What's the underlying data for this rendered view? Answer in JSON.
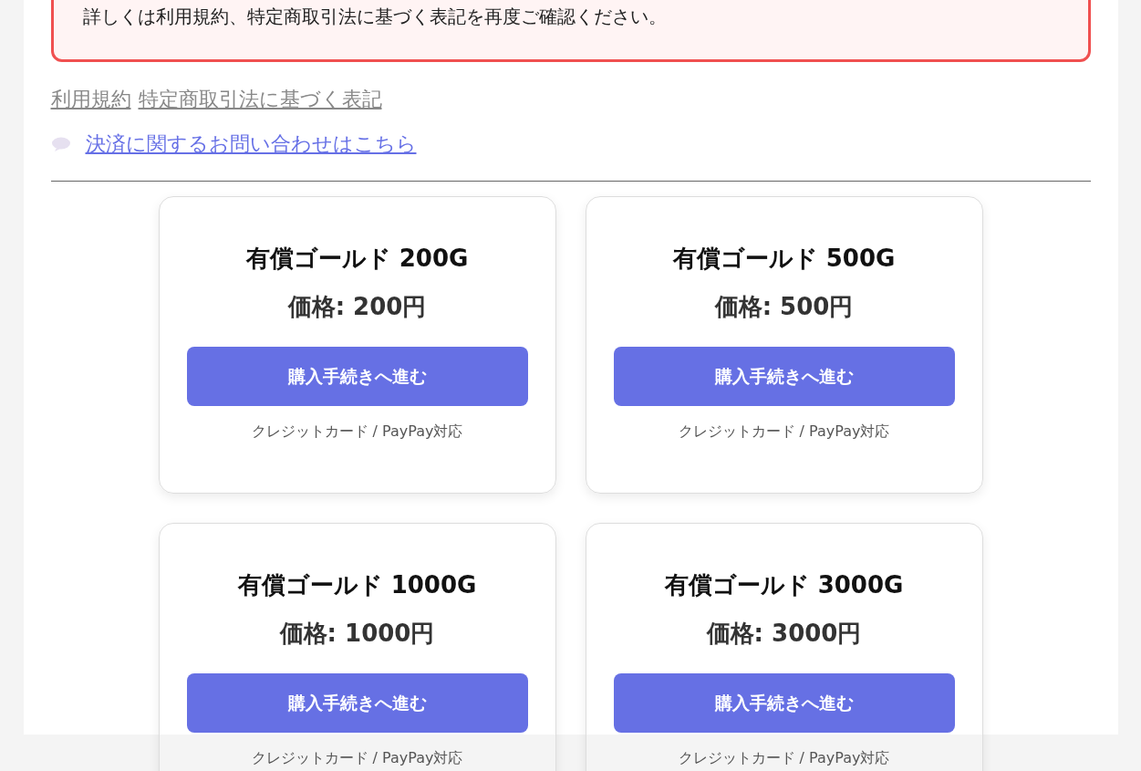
{
  "notice": {
    "text": "詳しくは利用規約、特定商取引法に基づく表記を再度ご確認ください。"
  },
  "legal_links": [
    {
      "label": "利用規約"
    },
    {
      "label": "特定商取引法に基づく表記"
    }
  ],
  "contact_link": {
    "label": "決済に関するお問い合わせはこちら"
  },
  "products": [
    {
      "title": "有償ゴールド 200G",
      "price": "価格: 200円",
      "button": "購入手続きへ進む",
      "note": "クレジットカード / PayPay対応"
    },
    {
      "title": "有償ゴールド 500G",
      "price": "価格: 500円",
      "button": "購入手続きへ進む",
      "note": "クレジットカード / PayPay対応"
    },
    {
      "title": "有償ゴールド 1000G",
      "price": "価格: 1000円",
      "button": "購入手続きへ進む",
      "note": "クレジットカード / PayPay対応"
    },
    {
      "title": "有償ゴールド 3000G",
      "price": "価格: 3000円",
      "button": "購入手続きへ進む",
      "note": "クレジットカード / PayPay対応"
    }
  ]
}
